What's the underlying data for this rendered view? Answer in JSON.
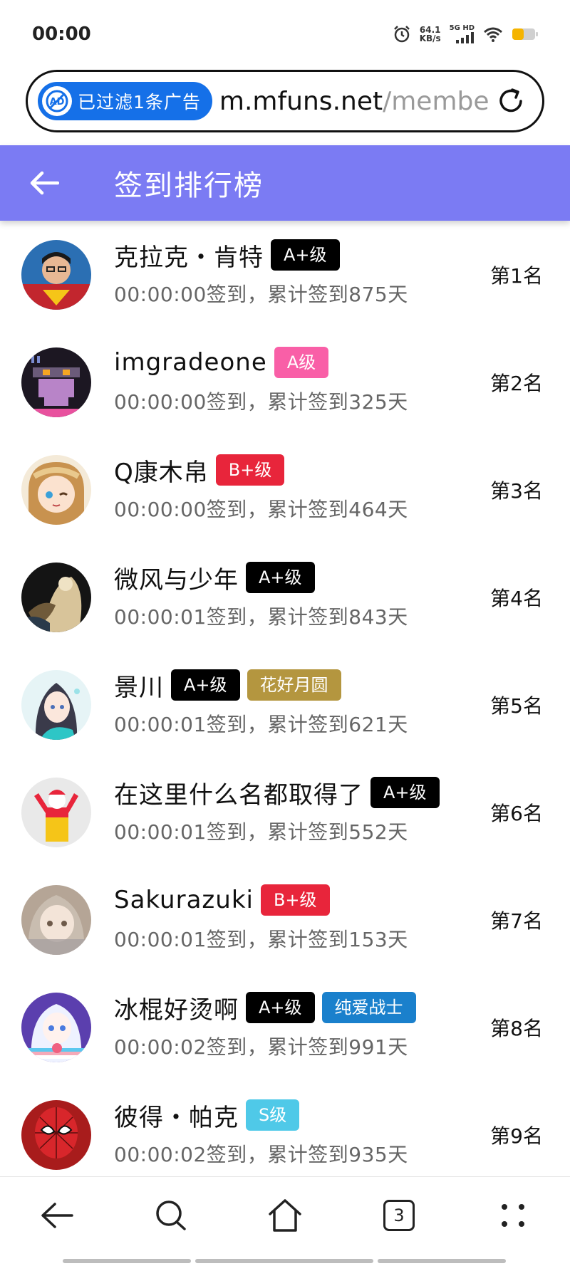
{
  "status_bar": {
    "time": "00:00",
    "net_speed_value": "64.1",
    "net_speed_unit": "KB/s",
    "network_label": "5G HD",
    "icons": [
      "alarm-icon",
      "signal-icon",
      "wifi-icon",
      "battery-icon"
    ],
    "battery_color": "#f5b400"
  },
  "address_bar": {
    "ad_icon_text": "AD",
    "ad_filter_text": "已过滤1条广告",
    "url_host": "m.mfuns.net",
    "url_path": "/membe"
  },
  "header": {
    "title": "签到排行榜",
    "background": "#7b7bf3"
  },
  "rows": [
    {
      "name": "克拉克・肯特",
      "badges": [
        {
          "label": "A+级",
          "color": "#000000"
        }
      ],
      "meta": "00:00:00签到，累计签到875天",
      "rank": "第1名",
      "avatar": "superman"
    },
    {
      "name": "imgradeone",
      "badges": [
        {
          "label": "A级",
          "color": "#f95fa7"
        }
      ],
      "meta": "00:00:00签到，累计签到325天",
      "rank": "第2名",
      "avatar": "pixel-creature"
    },
    {
      "name": "Q康木帛",
      "badges": [
        {
          "label": "B+级",
          "color": "#e8253b"
        }
      ],
      "meta": "00:00:00签到，累计签到464天",
      "rank": "第3名",
      "avatar": "anime-girl-wink"
    },
    {
      "name": "微风与少年",
      "badges": [
        {
          "label": "A+级",
          "color": "#000000"
        }
      ],
      "meta": "00:00:01签到，累计签到843天",
      "rank": "第4名",
      "avatar": "painting"
    },
    {
      "name": "景川",
      "badges": [
        {
          "label": "A+级",
          "color": "#000000"
        },
        {
          "label": "花好月圆",
          "color": "#b4963f"
        }
      ],
      "meta": "00:00:01签到，累计签到621天",
      "rank": "第5名",
      "avatar": "anime-girl-teal"
    },
    {
      "name": "在这里什么名都取得了",
      "badges": [
        {
          "label": "A+级",
          "color": "#000000"
        }
      ],
      "meta": "00:00:01签到，累计签到552天",
      "rank": "第6名",
      "avatar": "clown"
    },
    {
      "name": "Sakurazuki",
      "badges": [
        {
          "label": "B+级",
          "color": "#e8253b"
        }
      ],
      "meta": "00:00:01签到，累计签到153天",
      "rank": "第7名",
      "avatar": "anime-girl-grey"
    },
    {
      "name": "冰棍好烫啊",
      "badges": [
        {
          "label": "A+级",
          "color": "#000000"
        },
        {
          "label": "纯爱战士",
          "color": "#1a80cc"
        }
      ],
      "meta": "00:00:02签到，累计签到991天",
      "rank": "第8名",
      "avatar": "anime-girl-white"
    },
    {
      "name": "彼得・帕克",
      "badges": [
        {
          "label": "S级",
          "color": "#4fc9e8"
        }
      ],
      "meta": "00:00:02签到，累计签到935天",
      "rank": "第9名",
      "avatar": "spiderman"
    }
  ],
  "bottom_nav": {
    "items": [
      "back-icon",
      "search-icon",
      "home-icon",
      "tabs-icon",
      "menu-icon"
    ],
    "tab_count": "3"
  }
}
